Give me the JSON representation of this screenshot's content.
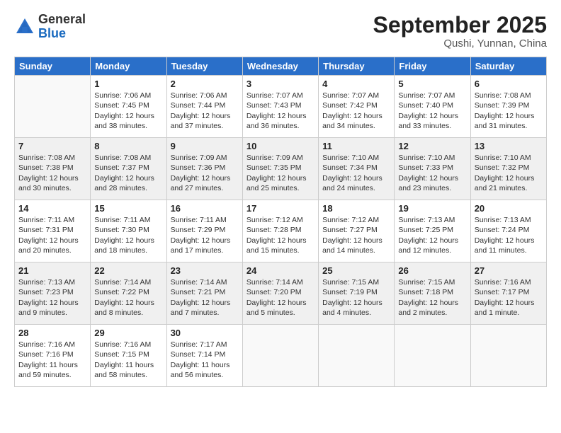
{
  "header": {
    "logo_general": "General",
    "logo_blue": "Blue",
    "month_title": "September 2025",
    "location": "Qushi, Yunnan, China"
  },
  "days_of_week": [
    "Sunday",
    "Monday",
    "Tuesday",
    "Wednesday",
    "Thursday",
    "Friday",
    "Saturday"
  ],
  "weeks": [
    [
      {
        "day": "",
        "info": ""
      },
      {
        "day": "1",
        "info": "Sunrise: 7:06 AM\nSunset: 7:45 PM\nDaylight: 12 hours\nand 38 minutes."
      },
      {
        "day": "2",
        "info": "Sunrise: 7:06 AM\nSunset: 7:44 PM\nDaylight: 12 hours\nand 37 minutes."
      },
      {
        "day": "3",
        "info": "Sunrise: 7:07 AM\nSunset: 7:43 PM\nDaylight: 12 hours\nand 36 minutes."
      },
      {
        "day": "4",
        "info": "Sunrise: 7:07 AM\nSunset: 7:42 PM\nDaylight: 12 hours\nand 34 minutes."
      },
      {
        "day": "5",
        "info": "Sunrise: 7:07 AM\nSunset: 7:40 PM\nDaylight: 12 hours\nand 33 minutes."
      },
      {
        "day": "6",
        "info": "Sunrise: 7:08 AM\nSunset: 7:39 PM\nDaylight: 12 hours\nand 31 minutes."
      }
    ],
    [
      {
        "day": "7",
        "info": "Sunrise: 7:08 AM\nSunset: 7:38 PM\nDaylight: 12 hours\nand 30 minutes."
      },
      {
        "day": "8",
        "info": "Sunrise: 7:08 AM\nSunset: 7:37 PM\nDaylight: 12 hours\nand 28 minutes."
      },
      {
        "day": "9",
        "info": "Sunrise: 7:09 AM\nSunset: 7:36 PM\nDaylight: 12 hours\nand 27 minutes."
      },
      {
        "day": "10",
        "info": "Sunrise: 7:09 AM\nSunset: 7:35 PM\nDaylight: 12 hours\nand 25 minutes."
      },
      {
        "day": "11",
        "info": "Sunrise: 7:10 AM\nSunset: 7:34 PM\nDaylight: 12 hours\nand 24 minutes."
      },
      {
        "day": "12",
        "info": "Sunrise: 7:10 AM\nSunset: 7:33 PM\nDaylight: 12 hours\nand 23 minutes."
      },
      {
        "day": "13",
        "info": "Sunrise: 7:10 AM\nSunset: 7:32 PM\nDaylight: 12 hours\nand 21 minutes."
      }
    ],
    [
      {
        "day": "14",
        "info": "Sunrise: 7:11 AM\nSunset: 7:31 PM\nDaylight: 12 hours\nand 20 minutes."
      },
      {
        "day": "15",
        "info": "Sunrise: 7:11 AM\nSunset: 7:30 PM\nDaylight: 12 hours\nand 18 minutes."
      },
      {
        "day": "16",
        "info": "Sunrise: 7:11 AM\nSunset: 7:29 PM\nDaylight: 12 hours\nand 17 minutes."
      },
      {
        "day": "17",
        "info": "Sunrise: 7:12 AM\nSunset: 7:28 PM\nDaylight: 12 hours\nand 15 minutes."
      },
      {
        "day": "18",
        "info": "Sunrise: 7:12 AM\nSunset: 7:27 PM\nDaylight: 12 hours\nand 14 minutes."
      },
      {
        "day": "19",
        "info": "Sunrise: 7:13 AM\nSunset: 7:25 PM\nDaylight: 12 hours\nand 12 minutes."
      },
      {
        "day": "20",
        "info": "Sunrise: 7:13 AM\nSunset: 7:24 PM\nDaylight: 12 hours\nand 11 minutes."
      }
    ],
    [
      {
        "day": "21",
        "info": "Sunrise: 7:13 AM\nSunset: 7:23 PM\nDaylight: 12 hours\nand 9 minutes."
      },
      {
        "day": "22",
        "info": "Sunrise: 7:14 AM\nSunset: 7:22 PM\nDaylight: 12 hours\nand 8 minutes."
      },
      {
        "day": "23",
        "info": "Sunrise: 7:14 AM\nSunset: 7:21 PM\nDaylight: 12 hours\nand 7 minutes."
      },
      {
        "day": "24",
        "info": "Sunrise: 7:14 AM\nSunset: 7:20 PM\nDaylight: 12 hours\nand 5 minutes."
      },
      {
        "day": "25",
        "info": "Sunrise: 7:15 AM\nSunset: 7:19 PM\nDaylight: 12 hours\nand 4 minutes."
      },
      {
        "day": "26",
        "info": "Sunrise: 7:15 AM\nSunset: 7:18 PM\nDaylight: 12 hours\nand 2 minutes."
      },
      {
        "day": "27",
        "info": "Sunrise: 7:16 AM\nSunset: 7:17 PM\nDaylight: 12 hours\nand 1 minute."
      }
    ],
    [
      {
        "day": "28",
        "info": "Sunrise: 7:16 AM\nSunset: 7:16 PM\nDaylight: 11 hours\nand 59 minutes."
      },
      {
        "day": "29",
        "info": "Sunrise: 7:16 AM\nSunset: 7:15 PM\nDaylight: 11 hours\nand 58 minutes."
      },
      {
        "day": "30",
        "info": "Sunrise: 7:17 AM\nSunset: 7:14 PM\nDaylight: 11 hours\nand 56 minutes."
      },
      {
        "day": "",
        "info": ""
      },
      {
        "day": "",
        "info": ""
      },
      {
        "day": "",
        "info": ""
      },
      {
        "day": "",
        "info": ""
      }
    ]
  ]
}
